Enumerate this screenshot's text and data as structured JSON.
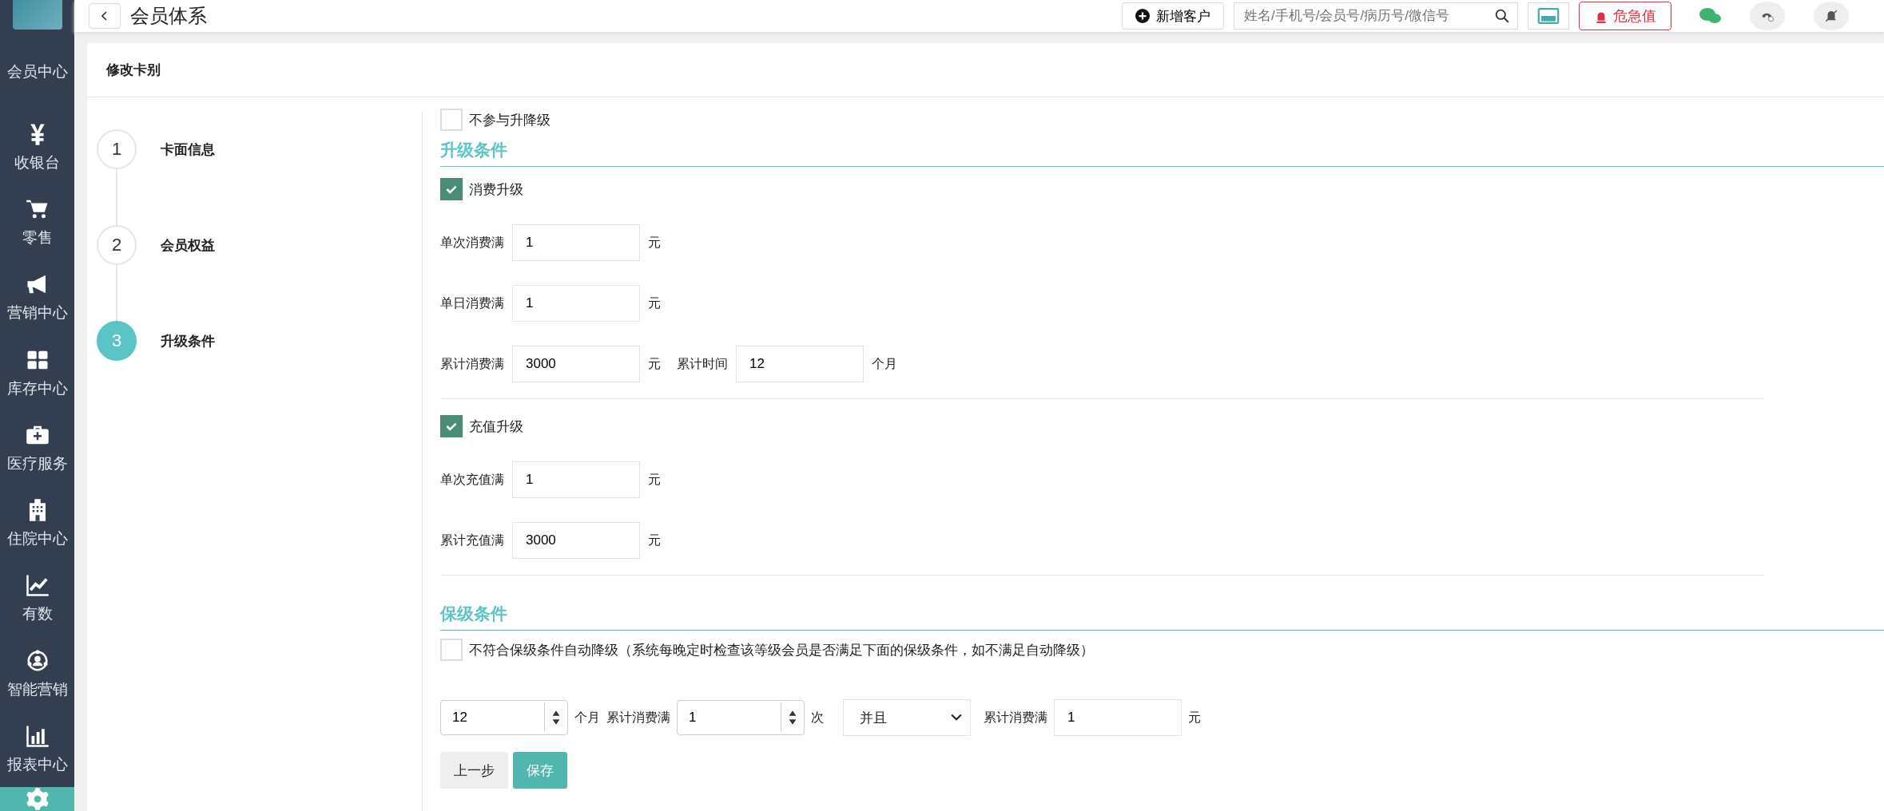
{
  "top_bar": {
    "title": "会员体系",
    "add_customer_button": "新增客户",
    "search": {
      "placeholder": "姓名/手机号/会员号/病历号/微信号"
    },
    "critical_button": "危急值"
  },
  "sidebar": {
    "items": [
      {
        "label": "会员中心",
        "selected": false
      },
      {
        "label": "收银台",
        "selected": false
      },
      {
        "label": "零售",
        "selected": false
      },
      {
        "label": "营销中心",
        "selected": false
      },
      {
        "label": "库存中心",
        "selected": false
      },
      {
        "label": "医疗服务",
        "selected": false
      },
      {
        "label": "住院中心",
        "selected": false
      },
      {
        "label": "有数",
        "selected": false
      },
      {
        "label": "智能营销",
        "selected": false
      },
      {
        "label": "报表中心",
        "selected": false
      },
      {
        "selected": true
      }
    ]
  },
  "card": {
    "title": "修改卡别"
  },
  "steps": [
    {
      "number": "1",
      "label": "卡面信息",
      "selected": false
    },
    {
      "number": "2",
      "label": "会员权益",
      "selected": false
    },
    {
      "number": "3",
      "label": "升级条件",
      "selected": true
    }
  ],
  "form": {
    "no_upgrade": {
      "label": "不参与升降级",
      "checked": false
    },
    "upgrade_section": {
      "title": "升级条件",
      "groups": [
        {
          "label": "消费升级",
          "checked": true,
          "rows": [
            {
              "fields": [
                {
                  "label": "单次消费满",
                  "value": "1",
                  "unit": "元"
                }
              ]
            },
            {
              "fields": [
                {
                  "label": "单日消费满",
                  "value": "1",
                  "unit": "元"
                }
              ]
            },
            {
              "fields": [
                {
                  "label": "累计消费满",
                  "value": "3000",
                  "unit": "元"
                },
                {
                  "label": "累计时间",
                  "value": "12",
                  "unit": "个月"
                }
              ]
            }
          ]
        },
        {
          "label": "充值升级",
          "checked": true,
          "rows": [
            {
              "fields": [
                {
                  "label": "单次充值满",
                  "value": "1",
                  "unit": "元"
                }
              ]
            },
            {
              "fields": [
                {
                  "label": "累计充值满",
                  "value": "3000",
                  "unit": "元"
                }
              ]
            }
          ]
        }
      ]
    },
    "retain_section": {
      "title": "保级条件",
      "auto_downgrade": {
        "label": "不符合保级条件自动降级（系统每晚定时检查该等级会员是否满足下面的保级条件，如不满足自动降级）",
        "checked": false
      },
      "condition": {
        "months": "12",
        "months_unit": "个月",
        "count_label": "累计消费满",
        "count": "1",
        "count_unit": "次",
        "logic": "并且",
        "amount_label": "累计消费满",
        "amount": "1",
        "amount_unit": "元"
      }
    },
    "buttons": [
      {
        "label": "上一步",
        "kind": "default"
      },
      {
        "label": "保存",
        "kind": "primary"
      }
    ]
  }
}
